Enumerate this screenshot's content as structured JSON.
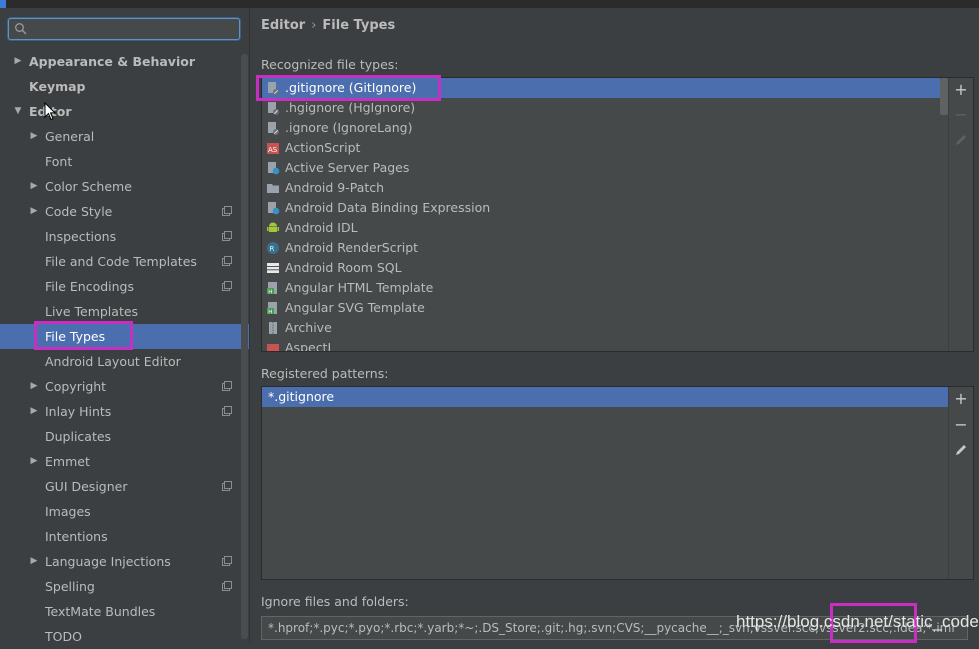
{
  "search": {
    "value": "",
    "placeholder": ""
  },
  "sidebar": {
    "items": [
      {
        "label": "Appearance & Behavior",
        "level": 0,
        "arrow": "right",
        "bold": true,
        "project": false
      },
      {
        "label": "Keymap",
        "level": 0,
        "arrow": "",
        "bold": true,
        "project": false
      },
      {
        "label": "Editor",
        "level": 0,
        "arrow": "down",
        "bold": true,
        "project": false
      },
      {
        "label": "General",
        "level": 1,
        "arrow": "right",
        "bold": false,
        "project": false
      },
      {
        "label": "Font",
        "level": 1,
        "arrow": "",
        "bold": false,
        "project": false
      },
      {
        "label": "Color Scheme",
        "level": 1,
        "arrow": "right",
        "bold": false,
        "project": false
      },
      {
        "label": "Code Style",
        "level": 1,
        "arrow": "right",
        "bold": false,
        "project": true
      },
      {
        "label": "Inspections",
        "level": 1,
        "arrow": "",
        "bold": false,
        "project": true
      },
      {
        "label": "File and Code Templates",
        "level": 1,
        "arrow": "",
        "bold": false,
        "project": true
      },
      {
        "label": "File Encodings",
        "level": 1,
        "arrow": "",
        "bold": false,
        "project": true
      },
      {
        "label": "Live Templates",
        "level": 1,
        "arrow": "",
        "bold": false,
        "project": false
      },
      {
        "label": "File Types",
        "level": 1,
        "arrow": "",
        "bold": false,
        "project": false,
        "selected": true
      },
      {
        "label": "Android Layout Editor",
        "level": 1,
        "arrow": "",
        "bold": false,
        "project": false
      },
      {
        "label": "Copyright",
        "level": 1,
        "arrow": "right",
        "bold": false,
        "project": true
      },
      {
        "label": "Inlay Hints",
        "level": 1,
        "arrow": "right",
        "bold": false,
        "project": true
      },
      {
        "label": "Duplicates",
        "level": 1,
        "arrow": "",
        "bold": false,
        "project": false
      },
      {
        "label": "Emmet",
        "level": 1,
        "arrow": "right",
        "bold": false,
        "project": false
      },
      {
        "label": "GUI Designer",
        "level": 1,
        "arrow": "",
        "bold": false,
        "project": true
      },
      {
        "label": "Images",
        "level": 1,
        "arrow": "",
        "bold": false,
        "project": false
      },
      {
        "label": "Intentions",
        "level": 1,
        "arrow": "",
        "bold": false,
        "project": false
      },
      {
        "label": "Language Injections",
        "level": 1,
        "arrow": "right",
        "bold": false,
        "project": true
      },
      {
        "label": "Spelling",
        "level": 1,
        "arrow": "",
        "bold": false,
        "project": true
      },
      {
        "label": "TextMate Bundles",
        "level": 1,
        "arrow": "",
        "bold": false,
        "project": false
      },
      {
        "label": "TODO",
        "level": 1,
        "arrow": "",
        "bold": false,
        "project": false
      }
    ]
  },
  "breadcrumb": {
    "parent": "Editor",
    "separator": "›",
    "current": "File Types"
  },
  "recognized": {
    "label": "Recognized file types:",
    "items": [
      {
        "label": ".gitignore (GitIgnore)",
        "icon": "ignore-file-icon",
        "selected": true
      },
      {
        "label": ".hgignore (HgIgnore)",
        "icon": "ignore-file-icon"
      },
      {
        "label": ".ignore (IgnoreLang)",
        "icon": "ignore-file-icon"
      },
      {
        "label": "ActionScript",
        "icon": "actionscript-icon"
      },
      {
        "label": "Active Server Pages",
        "icon": "asp-icon"
      },
      {
        "label": "Android 9-Patch",
        "icon": "folder-icon"
      },
      {
        "label": "Android Data Binding Expression",
        "icon": "data-binding-icon"
      },
      {
        "label": "Android IDL",
        "icon": "android-icon"
      },
      {
        "label": "Android RenderScript",
        "icon": "renderscript-icon"
      },
      {
        "label": "Android Room SQL",
        "icon": "sql-table-icon"
      },
      {
        "label": "Angular HTML Template",
        "icon": "html-template-icon"
      },
      {
        "label": "Angular SVG Template",
        "icon": "html-template-icon"
      },
      {
        "label": "Archive",
        "icon": "archive-icon"
      },
      {
        "label": "AspectJ",
        "icon": "aspectj-icon"
      }
    ]
  },
  "patterns": {
    "label": "Registered patterns:",
    "items": [
      {
        "label": "*.gitignore",
        "selected": true
      }
    ]
  },
  "ignore": {
    "label": "Ignore files and folders:",
    "value": "*.hprof;*.pyc;*.pyo;*.rbc;*.yarb;*~;.DS_Store;.git;.hg;.svn;CVS;__pycache__;_svn;vssver.scc;vssver2.scc;.idea;*.iml"
  },
  "watermark": "https://blog.csdn.net/static_coder",
  "colors": {
    "accent": "#4b6eaf",
    "highlight": "#c72fc2",
    "background": "#3c3f41",
    "panel": "#45494a"
  }
}
